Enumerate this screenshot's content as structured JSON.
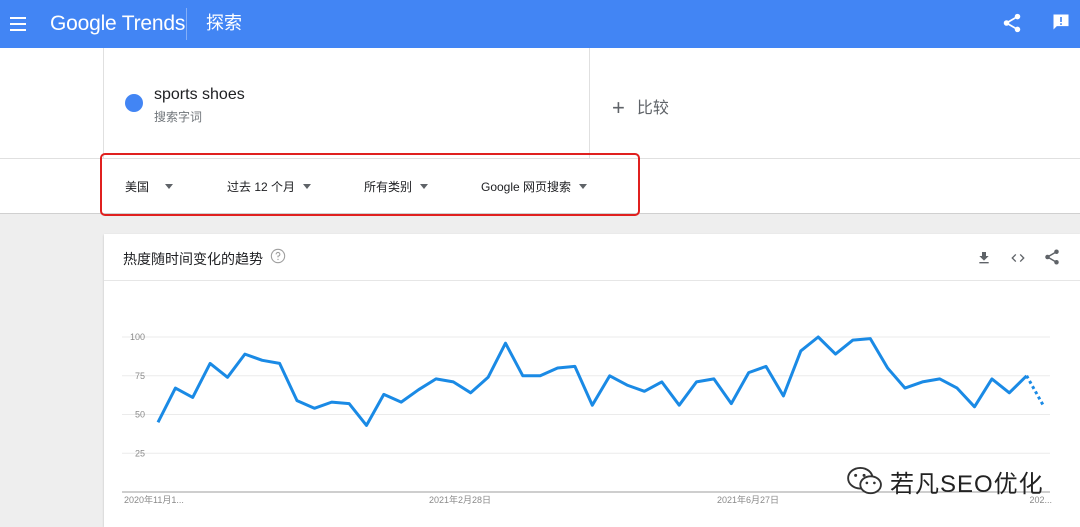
{
  "header": {
    "logo_text": "Google Trends",
    "title": "探索",
    "icons": [
      "menu-icon",
      "share-icon",
      "feedback-icon"
    ],
    "color": "#4285f4"
  },
  "search_term": {
    "name": "sports shoes",
    "type": "搜索字词",
    "color": "#4285f4"
  },
  "compare": {
    "plus": "+",
    "label": "比较"
  },
  "filters": {
    "region": "美国",
    "time_range": "过去 12 个月",
    "category": "所有类别",
    "search_type": "Google 网页搜索",
    "highlight_color": "#e0201f"
  },
  "card": {
    "title": "热度随时间变化的趋势",
    "icons": [
      "help-icon",
      "download-icon",
      "embed-icon",
      "share-icon"
    ]
  },
  "chart_data": {
    "type": "line",
    "series": [
      {
        "name": "sports shoes",
        "color": "#1a8ae5",
        "values": [
          45,
          67,
          61,
          83,
          74,
          89,
          85,
          83,
          59,
          54,
          58,
          57,
          43,
          63,
          58,
          66,
          73,
          71,
          64,
          74,
          96,
          75,
          75,
          80,
          81,
          56,
          75,
          69,
          65,
          71,
          56,
          71,
          73,
          57,
          77,
          81,
          62,
          91,
          100,
          89,
          98,
          99,
          80,
          67,
          71,
          73,
          67,
          55,
          73,
          64,
          75,
          55
        ],
        "partial_last_segment": true
      }
    ],
    "yticks": [
      25,
      50,
      75,
      100
    ],
    "ylim": [
      0,
      100
    ],
    "xtick_labels": [
      "2020年11月1...",
      "2021年2月28日",
      "2021年6月27日",
      "202..."
    ],
    "grid": true
  },
  "watermark": {
    "text": "若凡SEO优化"
  }
}
